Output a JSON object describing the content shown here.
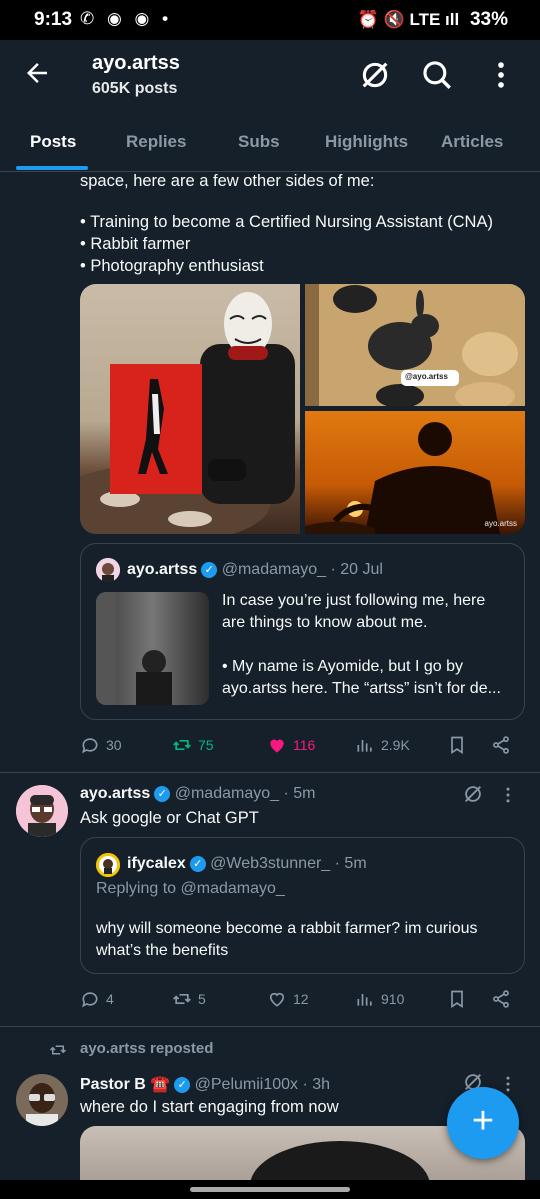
{
  "status_bar": {
    "time": "9:13",
    "left_icons": "✆ ◉ ◉ •",
    "right_icons": "⏰ 🔇 LTE ıll",
    "battery": "33%"
  },
  "header": {
    "title": "ayo.artss",
    "subtitle": "605K posts"
  },
  "tabs": [
    "Posts",
    "Replies",
    "Subs",
    "Highlights",
    "Articles"
  ],
  "post1": {
    "text_lines": [
      "space, here are a few other sides of me:",
      "",
      "• Training to become a Certified Nursing Assistant (CNA)",
      "• Rabbit farmer",
      "• Photography enthusiast"
    ],
    "media_labels": {
      "rabbit_tag": "@ayo.artss",
      "sunset_tag": "ayo.artss"
    },
    "quote": {
      "name": "ayo.artss",
      "handle": "@madamayo_",
      "date": "· 20 Jul",
      "text_lines": [
        "In case you’re just following me, here",
        "are things to know about me.",
        "",
        "• My name is Ayomide, but I go by",
        "ayo.artss here. The “artss” isn’t for de..."
      ]
    },
    "stats": {
      "replies": "30",
      "reposts": "75",
      "likes": "116",
      "views": "2.9K"
    }
  },
  "post2": {
    "name": "ayo.artss",
    "handle": "@madamayo_",
    "time": "· 5m",
    "text": "Ask google or Chat GPT",
    "quote": {
      "name": "ifycalex",
      "handle": "@Web3stunner_",
      "time": "· 5m",
      "replying": "Replying to @madamayo_",
      "text_lines": [
        "why will someone become a rabbit farmer? im curious",
        "what’s the benefits"
      ]
    },
    "stats": {
      "replies": "4",
      "reposts": "5",
      "likes": "12",
      "views": "910"
    }
  },
  "post3": {
    "repost_label": "ayo.artss reposted",
    "name": "Pastor B",
    "emoji": "☎️",
    "handle": "@Pelumii100x",
    "time": "· 3h",
    "text": "where do I start engaging from now"
  },
  "colors": {
    "background": "#15202b",
    "accent": "#1d9bf0",
    "repost_green": "#00ba7c",
    "like_pink": "#f91880",
    "muted": "#8b98a5"
  },
  "icons": {
    "back": "arrow-left-icon",
    "grok": "grok-icon",
    "search": "search-icon",
    "more": "more-vertical-icon",
    "fab": "plus-icon"
  }
}
